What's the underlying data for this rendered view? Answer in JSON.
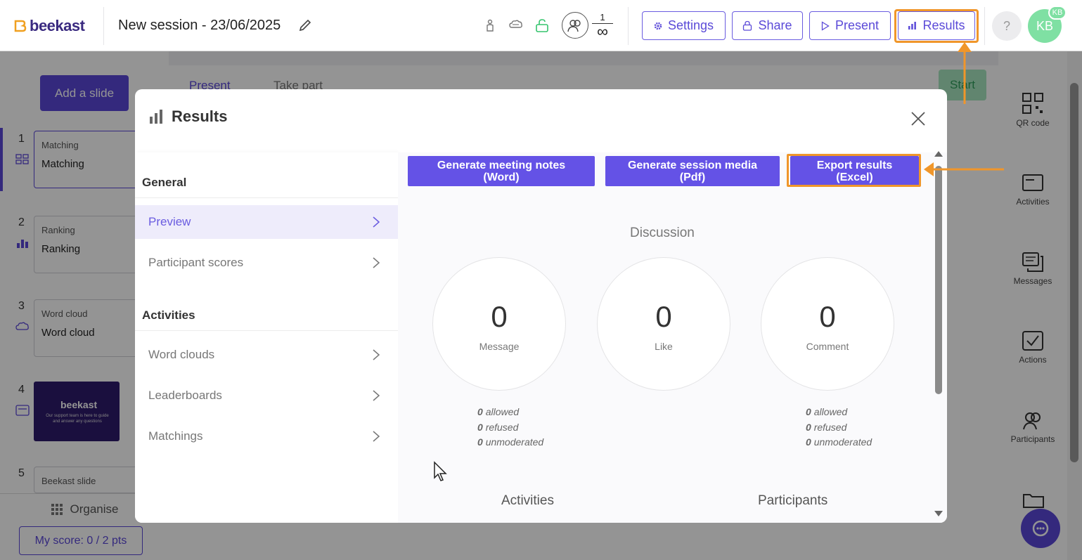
{
  "app": {
    "logo_text": "beekast",
    "session_title": "New session - 23/06/2025"
  },
  "participants": {
    "current": "1",
    "max": "∞"
  },
  "toolbar": {
    "settings_label": "Settings",
    "share_label": "Share",
    "present_label": "Present",
    "results_label": "Results",
    "help_label": "?",
    "avatar_initials": "KB",
    "avatar_badge": "KB"
  },
  "left_panel": {
    "add_slide_label": "Add a slide",
    "slides": [
      {
        "num": "1",
        "type": "Matching",
        "name": "Matching"
      },
      {
        "num": "2",
        "type": "Ranking",
        "name": "Ranking"
      },
      {
        "num": "3",
        "type": "Word cloud",
        "name": "Word cloud"
      },
      {
        "num": "4",
        "type": "",
        "name": "",
        "thumb_logo": "beekast",
        "thumb_text": "Our support team is here to guide and answer any questions"
      },
      {
        "num": "5",
        "type": "Beekast slide",
        "name": ""
      }
    ],
    "organise_label": "Organise",
    "my_score_label": "My score: 0 / 2 pts"
  },
  "center_panel": {
    "tab_present": "Present",
    "tab_take_part": "Take part",
    "start_label": "Start"
  },
  "right_rail": {
    "items": [
      {
        "label": "QR code",
        "icon": "qr-code-icon"
      },
      {
        "label": "Activities",
        "icon": "activities-icon"
      },
      {
        "label": "Messages",
        "icon": "messages-icon"
      },
      {
        "label": "Actions",
        "icon": "actions-icon"
      },
      {
        "label": "Participants",
        "icon": "participants-icon"
      }
    ]
  },
  "modal": {
    "title": "Results",
    "nav": {
      "general_heading": "General",
      "general_items": [
        "Preview",
        "Participant scores"
      ],
      "activities_heading": "Activities",
      "activities_items": [
        "Word clouds",
        "Leaderboards",
        "Matchings"
      ]
    },
    "buttons": {
      "meeting_notes_line1": "Generate meeting notes",
      "meeting_notes_line2": "(Word)",
      "session_media_line1": "Generate session media",
      "session_media_line2": "(Pdf)",
      "export_line1": "Export results",
      "export_line2": "(Excel)"
    },
    "discussion": {
      "title": "Discussion",
      "stats": [
        {
          "value": "0",
          "label": "Message"
        },
        {
          "value": "0",
          "label": "Like"
        },
        {
          "value": "0",
          "label": "Comment"
        }
      ],
      "message_moderation": {
        "allowed": "0",
        "refused": "0",
        "unmoderated": "0"
      },
      "comment_moderation": {
        "allowed": "0",
        "refused": "0",
        "unmoderated": "0"
      },
      "allowed_label": "allowed",
      "refused_label": "refused",
      "unmoderated_label": "unmoderated"
    },
    "activities_title": "Activities",
    "participants_title": "Participants"
  },
  "colors": {
    "brand": "#5a47d8",
    "accent_button": "#6452e6",
    "highlight": "#f0962a",
    "avatar": "#7fe0a3"
  }
}
